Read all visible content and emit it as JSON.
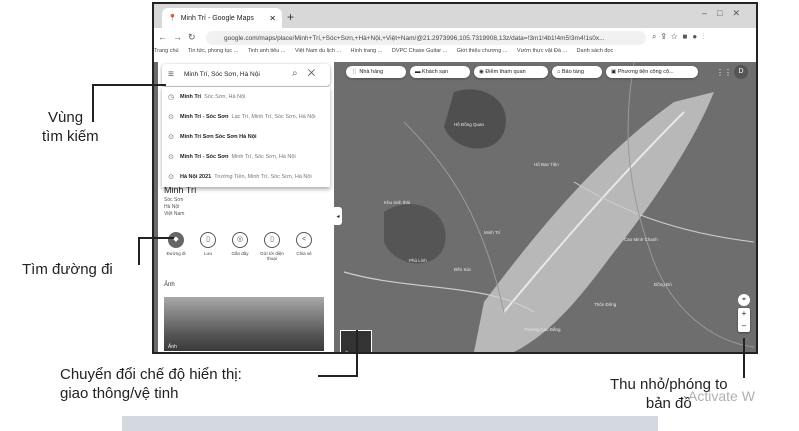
{
  "tab": {
    "title": "Minh Trí - Google Maps"
  },
  "address_bar": {
    "url": "google.com/maps/place/Minh+Trí,+Sóc+Sơn,+Hà+Nội,+Việt+Nam/@21.2973996,105.7319908,13z/data=!3m1!4b1!4m5!3m4!1s0x..."
  },
  "bookmarks": [
    "Trang chủ",
    "Tin tức, phong tục ...",
    "Tinh anh tiêu ...",
    "Việt Nam du lịch ...",
    "Hình trang ...",
    "DVPC Chase Guitar ...",
    "Giới thiệu chương ...",
    "Vườn thực vật Đà ...",
    "Danh sách đọc"
  ],
  "search": {
    "query": "Minh Trí, Sóc Sơn, Hà Nội",
    "suggestions": [
      {
        "main": "Minh Trí",
        "sub": "Sóc Sơn, Hà Nội"
      },
      {
        "main": "Minh Trí - Sóc Sơn",
        "sub": "Lạc Trí, Minh Trí, Sóc Sơn, Hà Nội"
      },
      {
        "main": "Minh Trí Sơn Sóc Sơn Hà Nội",
        "sub": ""
      },
      {
        "main": "Minh Trí - Sóc Sơn",
        "sub": "Minh Trí, Sóc Sơn, Hà Nội"
      },
      {
        "main": "Hà Nội 2021",
        "sub": "Trường Tiền, Minh Trí, Sóc Sơn, Hà Nội"
      }
    ]
  },
  "place": {
    "title": "Minh Trí",
    "info": [
      "Sóc Sơn",
      "Hà Nội",
      "Việt Nam"
    ]
  },
  "actions": [
    "Đường đi",
    "Lưu",
    "Gần đây",
    "Gửi tới điện thoại",
    "Chia sẻ"
  ],
  "photos_label": "Ảnh",
  "photo_caption": "Ảnh",
  "chips": [
    "Nhà hàng",
    "Khách sạn",
    "Điểm tham quan",
    "Bảo tàng",
    "Phương tiện công cộ..."
  ],
  "map_labels": [
    "Minh Trí",
    "Hồ Đồng Quan",
    "Khu sinh thái",
    "Phù Linh",
    "Đền Sóc",
    "Cao Minh Chanh",
    "Trường Cao Đẳng",
    "Đồng Đò",
    "Hồ Ban Tiện",
    "Thôn Đông"
  ],
  "annotations": {
    "search_area": [
      "Vùng",
      "tìm kiếm"
    ],
    "directions": "Tìm đường đi",
    "layer_switch": [
      "Chuyển đổi chế độ hiển thị:",
      "giao thông/vệ tinh"
    ],
    "zoom": [
      "Thu nhỏ/phóng to",
      "bản đồ"
    ]
  },
  "watermark": "Activate W"
}
